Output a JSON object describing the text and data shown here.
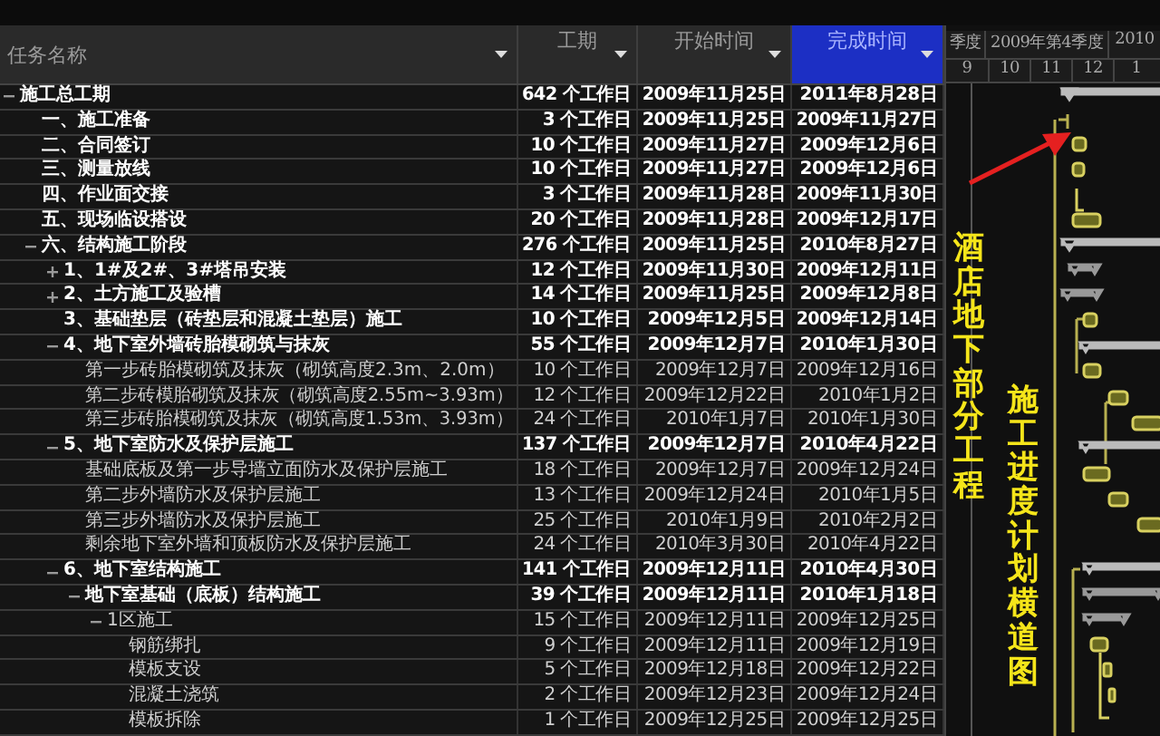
{
  "columns": [
    {
      "label": "任务名称",
      "selected": false
    },
    {
      "label": "工期",
      "selected": false
    },
    {
      "label": "开始时间",
      "selected": false
    },
    {
      "label": "完成时间",
      "selected": true
    }
  ],
  "timescale": {
    "upper": [
      "季度",
      "2009年第4季度",
      "2010"
    ],
    "lower": [
      "9",
      "10",
      "11",
      "12",
      "1"
    ]
  },
  "tasks": [
    {
      "name": "施工总工期",
      "duration": "642 个工作日",
      "start": "2009年11月25日",
      "finish": "2011年8月28日",
      "kind": "summary",
      "expanded": true,
      "children": [
        {
          "name": "一、施工准备",
          "duration": "3 个工作日",
          "start": "2009年11月25日",
          "finish": "2009年11月27日",
          "kind": "summary"
        },
        {
          "name": "二、合同签订",
          "duration": "10 个工作日",
          "start": "2009年11月27日",
          "finish": "2009年12月6日",
          "kind": "summary"
        },
        {
          "name": "三、测量放线",
          "duration": "10 个工作日",
          "start": "2009年11月27日",
          "finish": "2009年12月6日",
          "kind": "summary"
        },
        {
          "name": "四、作业面交接",
          "duration": "3 个工作日",
          "start": "2009年11月28日",
          "finish": "2009年11月30日",
          "kind": "summary"
        },
        {
          "name": "五、现场临设搭设",
          "duration": "20 个工作日",
          "start": "2009年11月28日",
          "finish": "2009年12月17日",
          "kind": "summary"
        },
        {
          "name": "六、结构施工阶段",
          "duration": "276 个工作日",
          "start": "2009年11月25日",
          "finish": "2010年8月27日",
          "kind": "summary",
          "expanded": true,
          "children": [
            {
              "name": "1、1#及2#、3#塔吊安装",
              "duration": "12 个工作日",
              "start": "2009年11月30日",
              "finish": "2009年12月11日",
              "kind": "summary",
              "expanded": false
            },
            {
              "name": "2、土方施工及验槽",
              "duration": "14 个工作日",
              "start": "2009年11月25日",
              "finish": "2009年12月8日",
              "kind": "summary",
              "expanded": false
            },
            {
              "name": "3、基础垫层（砖垫层和混凝土垫层）施工",
              "duration": "10 个工作日",
              "start": "2009年12月5日",
              "finish": "2009年12月14日",
              "kind": "summary"
            },
            {
              "name": "4、地下室外墙砖胎模砌筑与抹灰",
              "duration": "55 个工作日",
              "start": "2009年12月7日",
              "finish": "2010年1月30日",
              "kind": "summary",
              "expanded": true,
              "children": [
                {
                  "name": "第一步砖胎模砌筑及抹灰（砌筑高度2.3m、2.0m）",
                  "duration": "10 个工作日",
                  "start": "2009年12月7日",
                  "finish": "2009年12月16日",
                  "kind": "task"
                },
                {
                  "name": "第二步砖模胎砌筑及抹灰（砌筑高度2.55m~3.93m）",
                  "duration": "12 个工作日",
                  "start": "2009年12月22日",
                  "finish": "2010年1月2日",
                  "kind": "task"
                },
                {
                  "name": "第三步砖胎模砌筑及抹灰（砌筑高度1.53m、3.93m）",
                  "duration": "24 个工作日",
                  "start": "2010年1月7日",
                  "finish": "2010年1月30日",
                  "kind": "task"
                }
              ]
            },
            {
              "name": "5、地下室防水及保护层施工",
              "duration": "137 个工作日",
              "start": "2009年12月7日",
              "finish": "2010年4月22日",
              "kind": "summary",
              "expanded": true,
              "children": [
                {
                  "name": "基础底板及第一步导墙立面防水及保护层施工",
                  "duration": "18 个工作日",
                  "start": "2009年12月7日",
                  "finish": "2009年12月24日",
                  "kind": "task"
                },
                {
                  "name": "第二步外墙防水及保护层施工",
                  "duration": "13 个工作日",
                  "start": "2009年12月24日",
                  "finish": "2010年1月5日",
                  "kind": "task"
                },
                {
                  "name": "第三步外墙防水及保护层施工",
                  "duration": "25 个工作日",
                  "start": "2010年1月9日",
                  "finish": "2010年2月2日",
                  "kind": "task"
                },
                {
                  "name": "剩余地下室外墙和顶板防水及保护层施工",
                  "duration": "24 个工作日",
                  "start": "2010年3月30日",
                  "finish": "2010年4月22日",
                  "kind": "task"
                }
              ]
            },
            {
              "name": "6、地下室结构施工",
              "duration": "141 个工作日",
              "start": "2009年12月11日",
              "finish": "2010年4月30日",
              "kind": "summary",
              "expanded": true,
              "children": [
                {
                  "name": "地下室基础（底板）结构施工",
                  "duration": "39 个工作日",
                  "start": "2009年12月11日",
                  "finish": "2010年1月18日",
                  "kind": "summary",
                  "expanded": true,
                  "children": [
                    {
                      "name": "1区施工",
                      "duration": "15 个工作日",
                      "start": "2009年12月11日",
                      "finish": "2009年12月25日",
                      "kind": "task",
                      "expanded": true,
                      "children": [
                        {
                          "name": "钢筋绑扎",
                          "duration": "9 个工作日",
                          "start": "2009年12月11日",
                          "finish": "2009年12月19日",
                          "kind": "task"
                        },
                        {
                          "name": "模板支设",
                          "duration": "5 个工作日",
                          "start": "2009年12月18日",
                          "finish": "2009年12月22日",
                          "kind": "task"
                        },
                        {
                          "name": "混凝土浇筑",
                          "duration": "2 个工作日",
                          "start": "2009年12月23日",
                          "finish": "2009年12月24日",
                          "kind": "task"
                        },
                        {
                          "name": "模板拆除",
                          "duration": "1 个工作日",
                          "start": "2009年12月25日",
                          "finish": "2009年12月25日",
                          "kind": "task"
                        }
                      ]
                    }
                  ]
                }
              ]
            }
          ]
        }
      ]
    }
  ],
  "annotations": [
    {
      "text": "酒店地下部分工程"
    },
    {
      "text": "施工进度计划横道图"
    }
  ]
}
